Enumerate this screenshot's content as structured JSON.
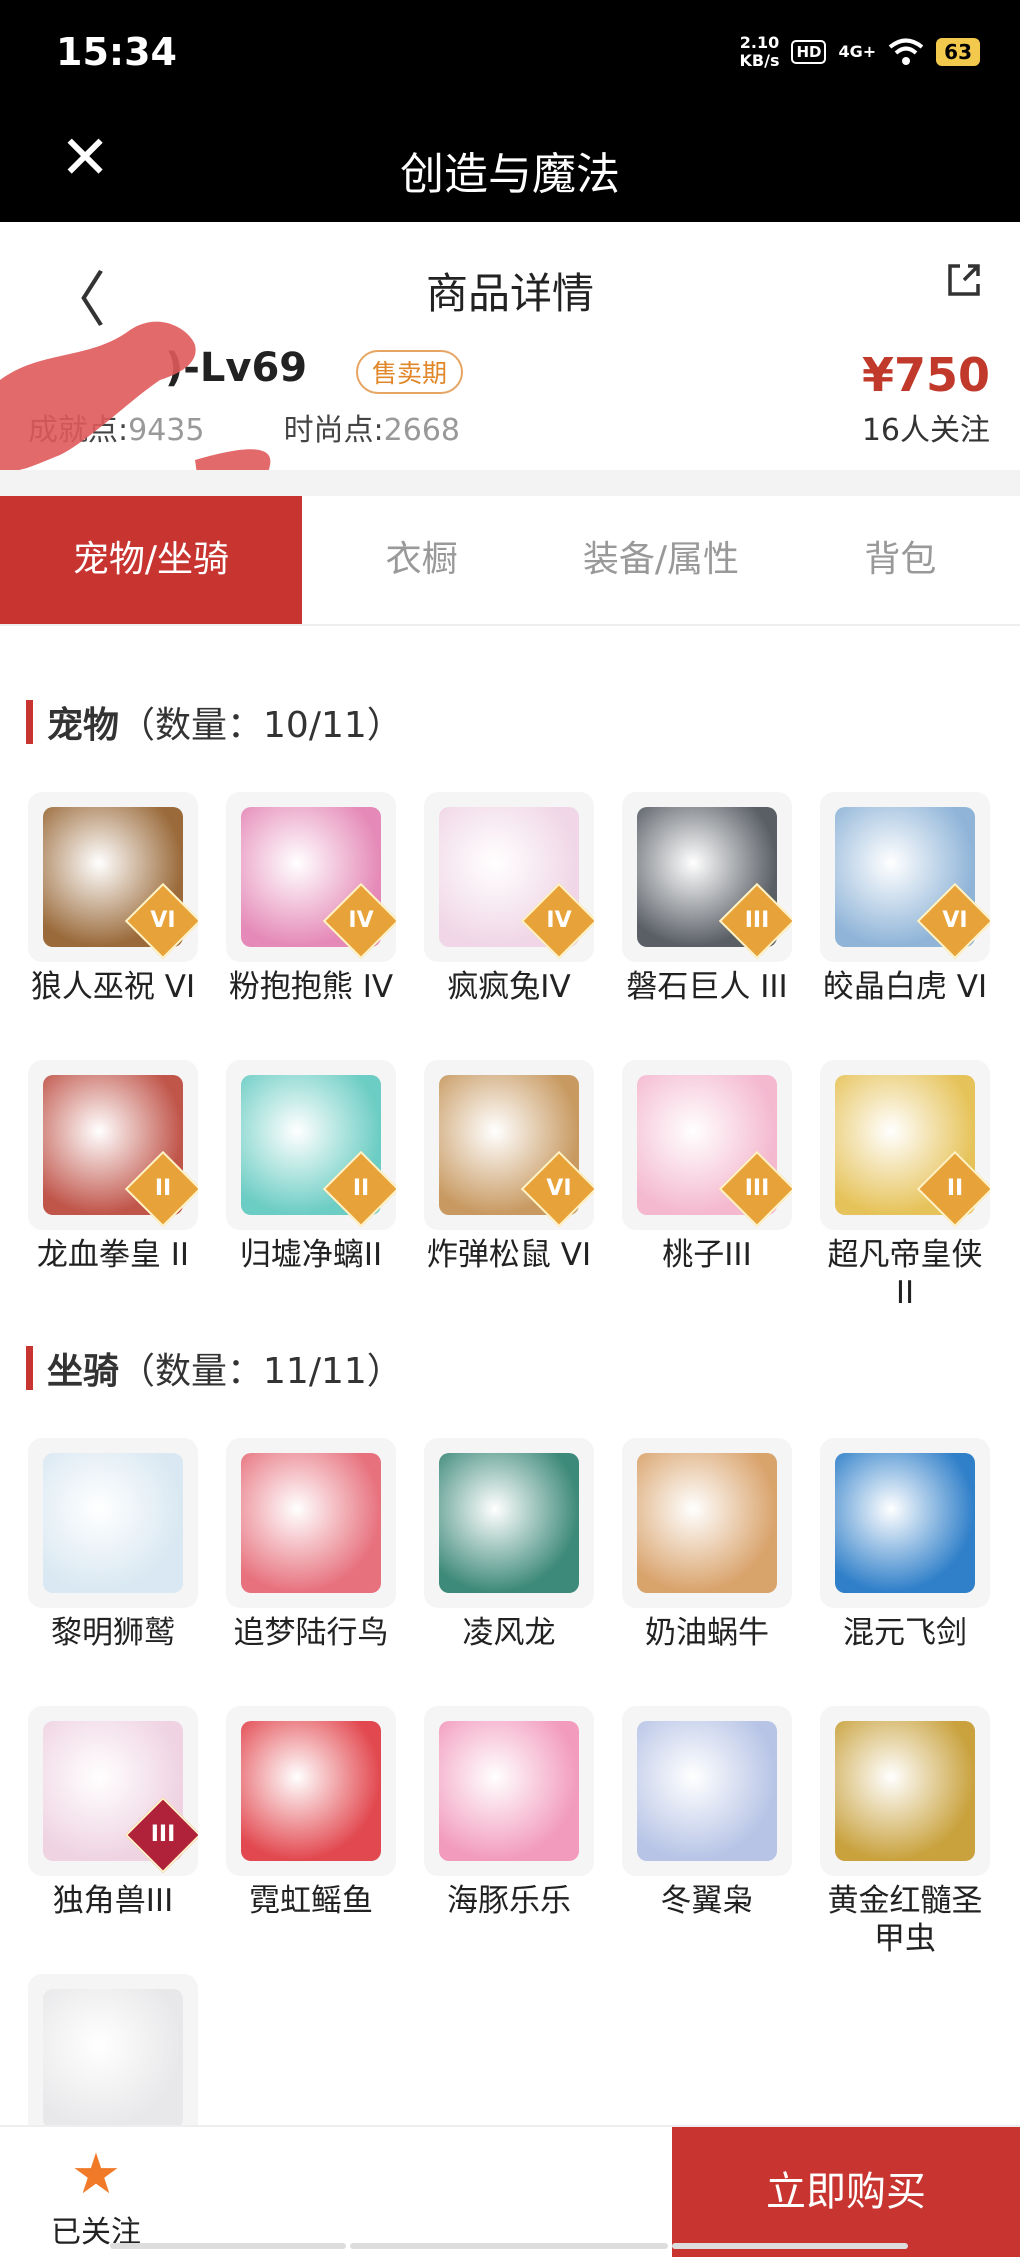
{
  "status_bar": {
    "time": "15:34",
    "net_speed": "2.10",
    "net_unit": "KB/s",
    "hd": "HD",
    "signal": "4G+",
    "battery": "63"
  },
  "app_bar": {
    "title": "创造与魔法"
  },
  "page": {
    "title": "商品详情"
  },
  "listing": {
    "name_suffix": ")-Lv69",
    "sale_badge": "售卖期",
    "price": "¥750",
    "achievement_label": "成就点:",
    "achievement_value": "9435",
    "fashion_label": "时尚点:",
    "fashion_value": "2668",
    "followers": "16人关注"
  },
  "tabs": [
    "宠物/坐骑",
    "衣橱",
    "装备/属性",
    "背包"
  ],
  "pets": {
    "heading": "宠物",
    "count": "（数量：10/11）",
    "items": [
      {
        "label": "狼人巫祝 VI",
        "rank": "VI",
        "color": "#9a6a3a"
      },
      {
        "label": "粉抱抱熊 IV",
        "rank": "IV",
        "color": "#e58ab8"
      },
      {
        "label": "疯疯兔IV",
        "rank": "IV",
        "color": "#f0d6e6"
      },
      {
        "label": "磐石巨人 III",
        "rank": "III",
        "color": "#5a5f66"
      },
      {
        "label": "皎晶白虎 VI",
        "rank": "VI",
        "color": "#8fb4d8"
      },
      {
        "label": "龙血拳皇 II",
        "rank": "II",
        "color": "#c0554a"
      },
      {
        "label": "归墟净螭II",
        "rank": "II",
        "color": "#6ccdc4"
      },
      {
        "label": "炸弹松鼠 VI",
        "rank": "VI",
        "color": "#c89a62"
      },
      {
        "label": "桃子III",
        "rank": "III",
        "color": "#f4b8cf"
      },
      {
        "label": "超凡帝皇侠 II",
        "rank": "II",
        "color": "#e6c35a"
      }
    ]
  },
  "mounts": {
    "heading": "坐骑",
    "count": "（数量：11/11）",
    "items": [
      {
        "label": "黎明狮鹫",
        "color": "#d9e8f2"
      },
      {
        "label": "追梦陆行鸟",
        "color": "#e7727e"
      },
      {
        "label": "凌风龙",
        "color": "#3e8a7a"
      },
      {
        "label": "奶油蜗牛",
        "color": "#d9a36c"
      },
      {
        "label": "混元飞剑",
        "color": "#2f7fc9"
      },
      {
        "label": "独角兽III",
        "rank": "III",
        "color": "#efd3e2"
      },
      {
        "label": "霓虹鳐鱼",
        "color": "#e2484f"
      },
      {
        "label": "海豚乐乐",
        "color": "#f29bbd"
      },
      {
        "label": "冬翼枭",
        "color": "#b7c4e6"
      },
      {
        "label": "黄金红髓圣甲虫",
        "color": "#c9a23e"
      },
      {
        "label": "",
        "color": "#e8e8ea"
      }
    ]
  },
  "bottom_bar": {
    "follow_label": "已关注",
    "buy_label": "立即购买"
  },
  "colors": {
    "accent": "#c83531",
    "badge": "#e0872a",
    "price": "#c0392b"
  }
}
